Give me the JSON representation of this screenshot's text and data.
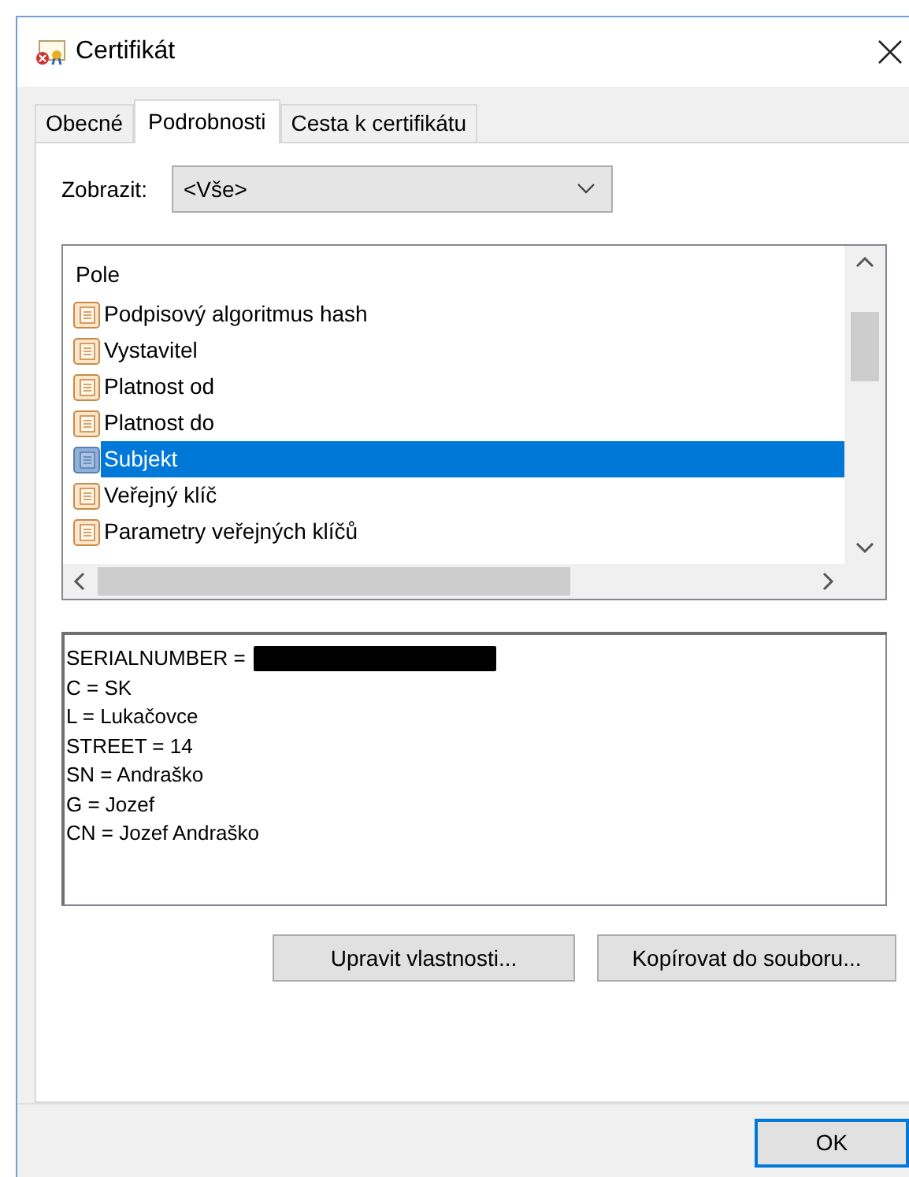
{
  "window": {
    "title": "Certifikát"
  },
  "tabs": [
    {
      "label": "Obecné",
      "selected": false
    },
    {
      "label": "Podrobnosti",
      "selected": true
    },
    {
      "label": "Cesta k certifikátu",
      "selected": false
    }
  ],
  "show": {
    "label": "Zobrazit:",
    "value": "<Vše>"
  },
  "fields": {
    "column": "Pole",
    "rows": [
      {
        "label": "Podpisový algoritmus hash",
        "selected": false
      },
      {
        "label": "Vystavitel",
        "selected": false
      },
      {
        "label": "Platnost od",
        "selected": false
      },
      {
        "label": "Platnost do",
        "selected": false
      },
      {
        "label": "Subjekt",
        "selected": true
      },
      {
        "label": "Veřejný klíč",
        "selected": false
      },
      {
        "label": "Parametry veřejných klíčů",
        "selected": false
      }
    ]
  },
  "details": [
    {
      "text": "SERIALNUMBER =",
      "redacted": true
    },
    {
      "text": "C = SK"
    },
    {
      "text": "L = Lukačovce"
    },
    {
      "text": "STREET = 14"
    },
    {
      "text": "SN = Andraško"
    },
    {
      "text": "G = Jozef"
    },
    {
      "text": "CN = Jozef Andraško"
    }
  ],
  "buttons": [
    "Upravit vlastnosti...",
    "Kopírovat do souboru..."
  ],
  "footer_button": "OK"
}
